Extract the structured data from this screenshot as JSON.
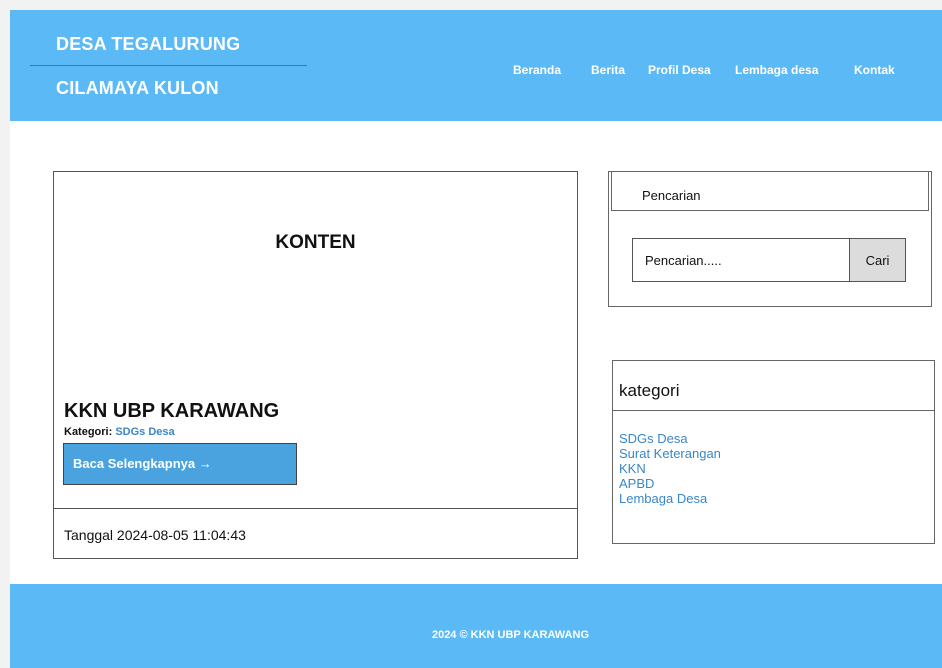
{
  "header": {
    "brand_line1": "DESA TEGALURUNG",
    "brand_line2": "CILAMAYA KULON",
    "nav": [
      "Beranda",
      "Berita",
      "Profil Desa",
      "Lembaga desa",
      "Kontak"
    ]
  },
  "main": {
    "content_title": "KONTEN",
    "post": {
      "title": "KKN UBP KARAWANG",
      "category_label": "Kategori:",
      "category_value": "SDGs Desa",
      "read_more": "Baca Selengkapnya →",
      "date": "Tanggal 2024-08-05 11:04:43"
    }
  },
  "sidebar": {
    "search": {
      "title": "Pencarian",
      "placeholder": "Pencarian.....",
      "button": "Cari"
    },
    "categories": {
      "title": "kategori",
      "items": [
        "SDGs Desa",
        "Surat Keterangan",
        "KKN",
        "APBD",
        "Lembaga Desa"
      ]
    }
  },
  "footer": {
    "text": "2024 © KKN UBP KARAWANG"
  },
  "colors": {
    "header_bg": "#5bbaf6",
    "button_bg": "#4aa3df",
    "link": "#3a86c8"
  }
}
